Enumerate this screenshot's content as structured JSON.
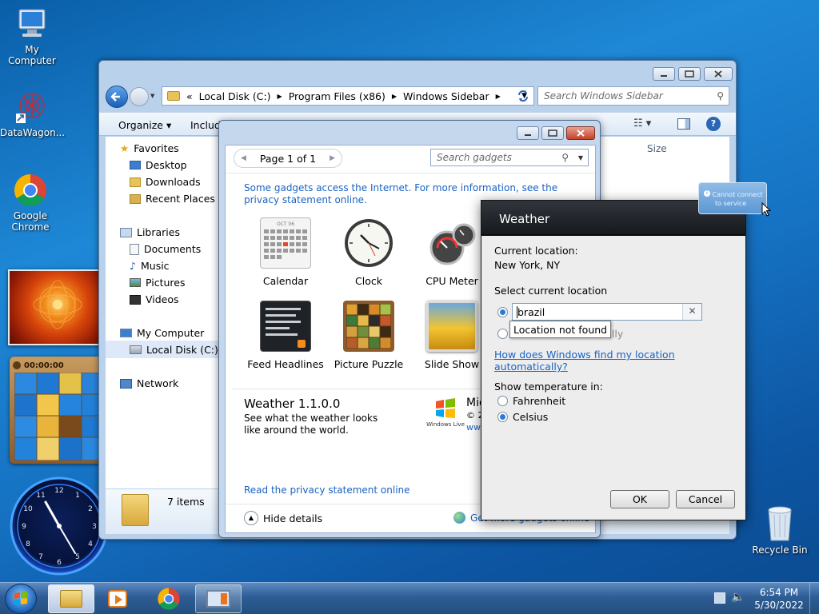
{
  "desktop": {
    "icons": [
      {
        "label": "My Computer"
      },
      {
        "label": "DataWagon..."
      },
      {
        "label": "Google Chrome"
      },
      {
        "label": "Recycle Bin"
      }
    ],
    "slideshow_image": "orange-flower",
    "puzzle_timer": "00:00:00"
  },
  "explorer": {
    "breadcrumb": [
      "Local Disk (C:)",
      "Program Files (x86)",
      "Windows Sidebar"
    ],
    "breadcrumb_prefix": "«",
    "search_placeholder": "Search Windows Sidebar",
    "toolbar": {
      "organize": "Organize",
      "include": "Includ"
    },
    "column_size": "Size",
    "nav": {
      "favorites": "Favorites",
      "desktop": "Desktop",
      "downloads": "Downloads",
      "recent": "Recent Places",
      "libraries": "Libraries",
      "documents": "Documents",
      "music": "Music",
      "pictures": "Pictures",
      "videos": "Videos",
      "computer": "My Computer",
      "local_disk": "Local Disk (C:)",
      "network": "Network"
    },
    "item_count": "7 items"
  },
  "gallery": {
    "page_label": "Page 1 of 1",
    "search_placeholder": "Search gadgets",
    "notice": "Some gadgets access the Internet.  For more information, see the privacy statement online.",
    "gadgets": [
      {
        "label": "Calendar",
        "icon": "calendar-icon"
      },
      {
        "label": "Clock",
        "icon": "clock-icon"
      },
      {
        "label": "CPU Meter",
        "icon": "cpu-meter-icon"
      },
      {
        "label": "Feed Headlines",
        "icon": "feed-headlines-icon"
      },
      {
        "label": "Picture Puzzle",
        "icon": "picture-puzzle-icon"
      },
      {
        "label": "Slide Show",
        "icon": "slide-show-icon"
      }
    ],
    "calendar_month": "OCT 06",
    "details_title": "Weather 1.1.0.0",
    "details_desc": "See what the weather looks like around the world.",
    "publisher_short": "Mic",
    "copyright_short": "© 2",
    "publisher_link_short": "ww",
    "windows_live": "Windows Live",
    "privacy_link": "Read the privacy statement online",
    "hide_details": "Hide details",
    "get_more": "Get more gadgets online"
  },
  "weather_dialog": {
    "title": "Weather",
    "current_location_label": "Current location:",
    "current_location_value": "New York, NY",
    "select_label": "Select current location",
    "search_value": "brazil",
    "tooltip": "Location not found",
    "auto_option_tail": "tically",
    "help_link": "How does Windows find my location automatically?",
    "temperature_label": "Show temperature in:",
    "fahrenheit": "Fahrenheit",
    "celsius": "Celsius",
    "selected_unit": "Celsius",
    "ok": "OK",
    "cancel": "Cancel"
  },
  "notification": {
    "line1": "Cannot connect",
    "line2": "to service"
  },
  "taskbar": {
    "time": "6:54 PM",
    "date": "5/30/2022"
  }
}
